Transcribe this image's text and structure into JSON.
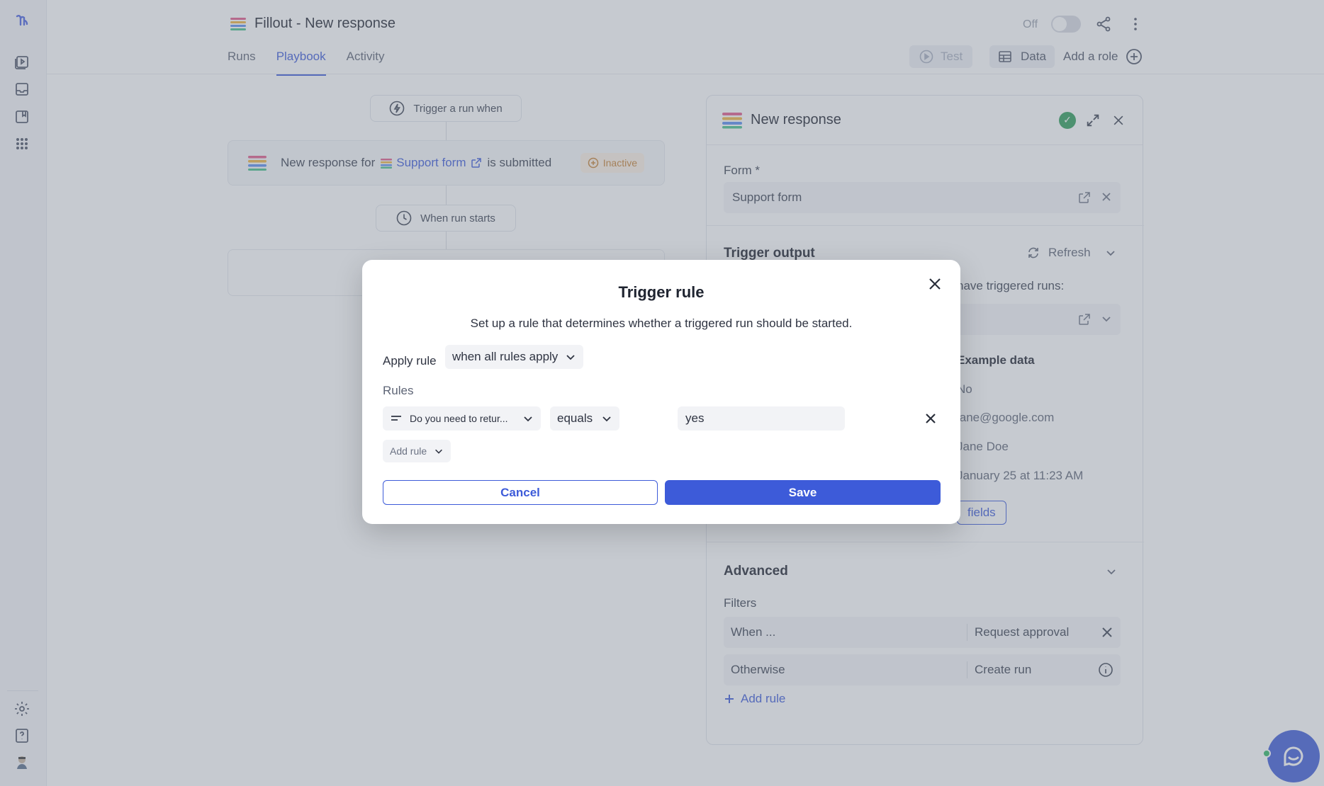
{
  "app": {
    "title": "Fillout - New response"
  },
  "header": {
    "tabs": [
      "Runs",
      "Playbook",
      "Activity"
    ],
    "active_tab": "Playbook",
    "toggle_label": "Off",
    "test_label": "Test",
    "data_label": "Data",
    "add_role_label": "Add a role"
  },
  "flow": {
    "trigger_pill": "Trigger a run when",
    "trigger_text_prefix": "New response for",
    "trigger_form_link": "Support form",
    "trigger_text_suffix": "is submitted",
    "trigger_status": "Inactive",
    "run_starts_pill": "When run starts"
  },
  "panel": {
    "title": "New response",
    "form_label": "Form *",
    "form_value": "Support form",
    "trigger_output_title": "Trigger output",
    "refresh_label": "Refresh",
    "runs_note_partial": "have triggered runs:",
    "example_data_title": "Example data",
    "example_values": [
      "No",
      "jane@google.com",
      "Jane Doe",
      "January 25 at 11:23 AM"
    ],
    "fields_button": "fields",
    "advanced_title": "Advanced",
    "filters_label": "Filters",
    "filters": [
      {
        "when": "When ...",
        "action": "Request approval"
      },
      {
        "when": "Otherwise",
        "action": "Create run"
      }
    ],
    "add_rule_link": "Add rule"
  },
  "modal": {
    "title": "Trigger rule",
    "description": "Set up a rule that determines whether a triggered run should be started.",
    "apply_label": "Apply rule",
    "apply_value": "when all rules apply",
    "rules_label": "Rules",
    "rule": {
      "field": "Do you need to retur...",
      "operator": "equals",
      "value": "yes"
    },
    "add_rule_label": "Add rule",
    "cancel_label": "Cancel",
    "save_label": "Save"
  },
  "colors": {
    "accent": "#3d5bd9",
    "success": "#2f9e5a",
    "warning": "#c78235"
  }
}
